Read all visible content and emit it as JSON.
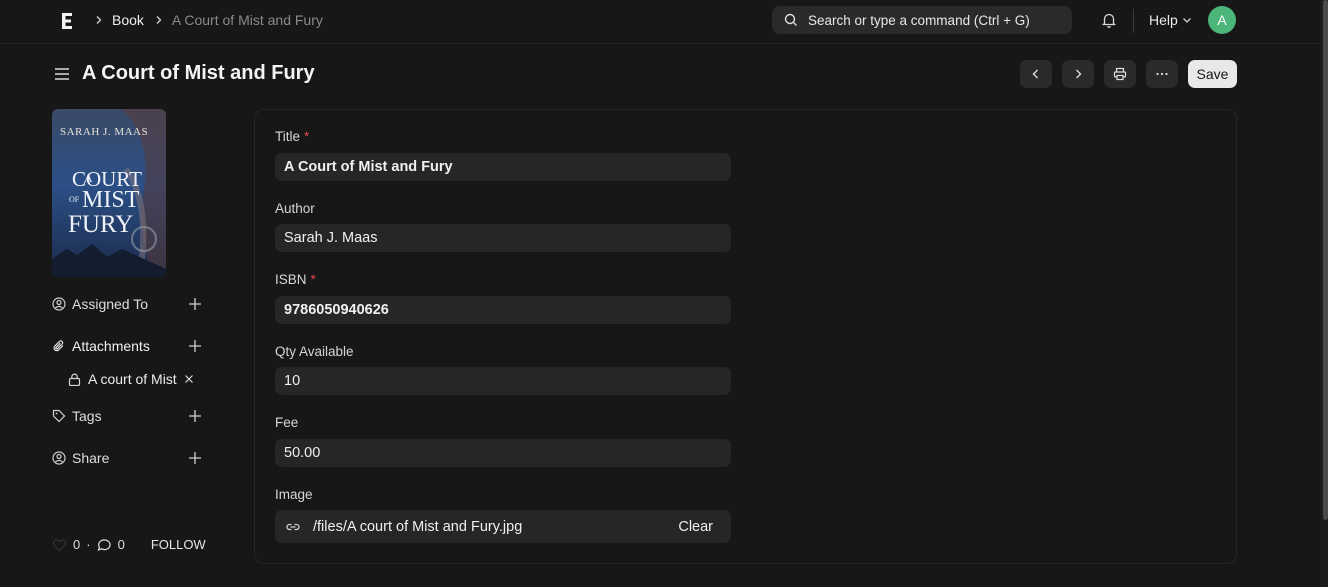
{
  "navbar": {
    "breadcrumb_root": "Book",
    "breadcrumb_current": "A Court of Mist and Fury",
    "search_placeholder": "Search or type a command (Ctrl + G)",
    "help_label": "Help",
    "avatar_initial": "A"
  },
  "page": {
    "title": "A Court of Mist and Fury",
    "save_label": "Save"
  },
  "sidebar": {
    "cover_author": "SARAH J. MAAS",
    "cover_title_line1": "COURT",
    "cover_title_of": "OF",
    "cover_title_line2": "MIST",
    "cover_title_line3": "FURY",
    "cover_title_a": "A",
    "assigned_to_label": "Assigned To",
    "attachments_label": "Attachments",
    "attachment_file": "A court of Mist",
    "tags_label": "Tags",
    "share_label": "Share",
    "likes_count": "0",
    "comments_count": "0",
    "follow_label": "FOLLOW"
  },
  "form": {
    "title_label": "Title",
    "title_value": "A Court of Mist and Fury",
    "author_label": "Author",
    "author_value": "Sarah J. Maas",
    "isbn_label": "ISBN",
    "isbn_value": "9786050940626",
    "qty_label": "Qty Available",
    "qty_value": "10",
    "fee_label": "Fee",
    "fee_value": "50.00",
    "image_label": "Image",
    "image_value": "/files/A court of Mist and Fury.jpg",
    "clear_label": "Clear",
    "required_mark": "*"
  },
  "colors": {
    "background": "#171717",
    "field": "#262626",
    "required": "#e5484d",
    "avatar": "#4bb57a"
  }
}
